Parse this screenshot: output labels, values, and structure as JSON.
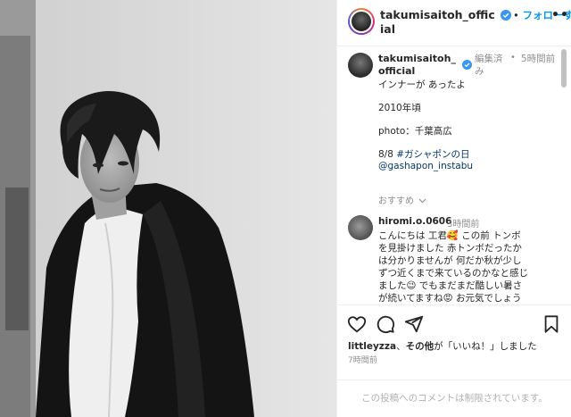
{
  "header": {
    "username": "takumisaitoh_official",
    "follow_label": "フォローする",
    "more_glyph": "•••"
  },
  "caption": {
    "username": "takumisaitoh_official",
    "edited": "編集済み",
    "time": "5時間前",
    "line1": "インナーが あったよ",
    "line2": "2010年頃",
    "line3": "photo：千葉高広",
    "line4_prefix": "8/8 ",
    "hashtag": "#ガシャポンの日",
    "mention": "@gashapon_instabu",
    "recommend": "おすすめ"
  },
  "comment": {
    "username": "hiromi.o.0606",
    "time": "3時間前",
    "lines": [
      "こんにちは 工君🥰 この前 トンボ",
      "を見掛けました 赤トンボだったか",
      "は分かりませんが 何だか秋が少し",
      "ずつ近くまで来ているのかなと感じ",
      "ました😉 でもまだまだ酷しい暑さ",
      "が続いてますね😡 お元気でしょう"
    ]
  },
  "likes": {
    "user": "littleyzza",
    "connector": "、",
    "others": "その他",
    "suffix": "が「いいね！」しました"
  },
  "post_time": "7時間前",
  "restricted_text": "この投稿へのコメントは制限されています。",
  "icons": {
    "like": "heart-icon",
    "comment": "comment-icon",
    "share": "share-icon",
    "save": "bookmark-icon",
    "verified": "verified-badge-icon"
  },
  "colors": {
    "accent": "#0095f6",
    "muted": "#8e8e8e",
    "link": "#00376b"
  }
}
